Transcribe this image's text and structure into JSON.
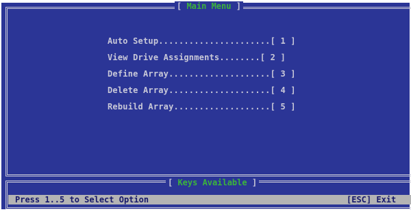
{
  "main_menu": {
    "title": "Main Menu",
    "items": [
      {
        "label": "Auto Setup",
        "dots": "......................",
        "key": "[ 1 ]"
      },
      {
        "label": "View Drive Assignments",
        "dots": "........",
        "key": "[ 2 ]"
      },
      {
        "label": "Define Array",
        "dots": "....................",
        "key": "[ 3 ]"
      },
      {
        "label": "Delete Array",
        "dots": "....................",
        "key": "[ 4 ]"
      },
      {
        "label": "Rebuild Array",
        "dots": "...................",
        "key": "[ 5 ]"
      }
    ]
  },
  "keys_panel": {
    "title": "Keys Available",
    "hint": "Press 1..5 to Select Option",
    "exit": "[ESC] Exit"
  },
  "colors": {
    "background": "#2b3596",
    "title_text": "#3cb43c",
    "menu_text": "#c8c8d8",
    "status_bar": "#b4b4b4",
    "status_text": "#16186a"
  }
}
